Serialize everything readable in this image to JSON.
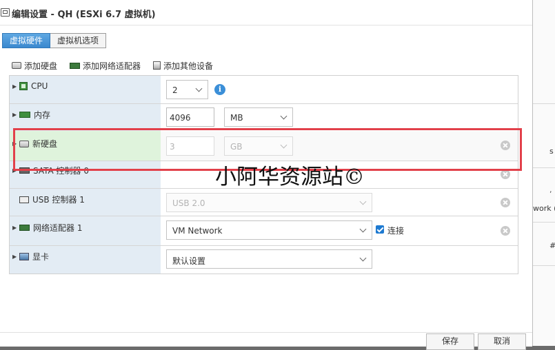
{
  "window": {
    "title": "编辑设置 - QH (ESXi 6.7 虚拟机)"
  },
  "tabs": [
    {
      "label": "虚拟硬件",
      "active": true
    },
    {
      "label": "虚拟机选项",
      "active": false
    }
  ],
  "toolbar": {
    "add_disk": "添加硬盘",
    "add_nic": "添加网络适配器",
    "add_other": "添加其他设备"
  },
  "hardware": {
    "cpu": {
      "label": "CPU",
      "value": "2"
    },
    "memory": {
      "label": "内存",
      "value": "4096",
      "unit": "MB"
    },
    "new_disk": {
      "label": "新硬盘",
      "value": "3",
      "unit": "GB"
    },
    "sata": {
      "label": "SATA 控制器 0"
    },
    "usb": {
      "label": "USB 控制器 1",
      "value": "USB 2.0"
    },
    "nic": {
      "label": "网络适配器 1",
      "value": "VM Network",
      "connect_label": "连接",
      "connected": true
    },
    "display": {
      "label": "显卡",
      "value": "默认设置"
    }
  },
  "background": {
    "texts": [
      "s",
      "work (",
      "#"
    ]
  },
  "watermark": "小阿华资源站©",
  "footer": {
    "save": "保存",
    "cancel": "取消"
  },
  "colors": {
    "accent": "#3a88cf",
    "highlight": "#e2404a",
    "left_column": "#e3ecf4",
    "selected_row": "#dff3dc"
  }
}
